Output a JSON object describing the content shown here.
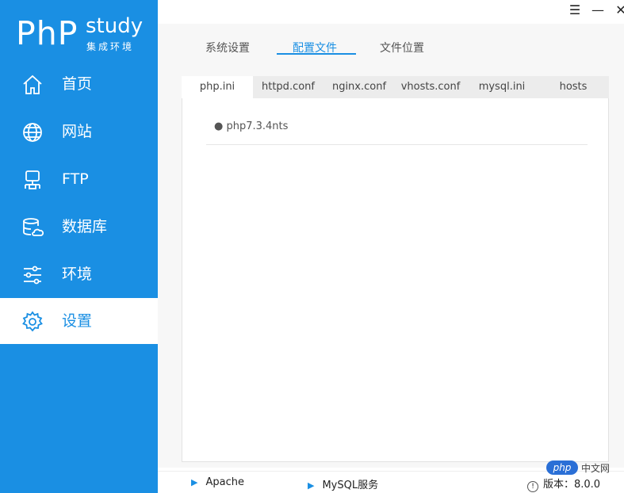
{
  "brand": {
    "logo_main": "PhP",
    "logo_study": "study",
    "logo_sub": "集成环境"
  },
  "window_controls": {
    "menu": "☰",
    "minimize": "—",
    "close": "✕"
  },
  "sidebar": {
    "items": [
      {
        "label": "首页",
        "icon": "home-icon"
      },
      {
        "label": "网站",
        "icon": "globe-icon"
      },
      {
        "label": "FTP",
        "icon": "ftp-icon"
      },
      {
        "label": "数据库",
        "icon": "database-icon"
      },
      {
        "label": "环境",
        "icon": "sliders-icon"
      },
      {
        "label": "设置",
        "icon": "gear-icon",
        "active": true
      }
    ]
  },
  "top_tabs": [
    "系统设置",
    "配置文件",
    "文件位置"
  ],
  "top_tab_active": "配置文件",
  "sub_tabs": [
    "php.ini",
    "httpd.conf",
    "nginx.conf",
    "vhosts.conf",
    "mysql.ini",
    "hosts"
  ],
  "sub_tab_active": "php.ini",
  "files": [
    "● php7.3.4nts"
  ],
  "status": {
    "service1": "Apache",
    "service2": "MySQL服务",
    "version": "版本：8.0.0"
  },
  "watermark": {
    "badge": "php",
    "text": "中文网"
  },
  "colors": {
    "accent": "#1a8fe3",
    "sidebar_bg": "#1a8fe3"
  }
}
